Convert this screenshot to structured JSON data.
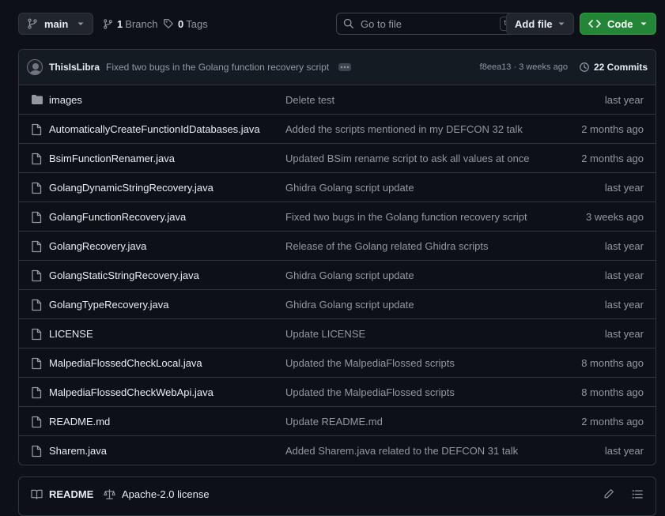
{
  "topbar": {
    "branch": "main",
    "branch_count": "1",
    "branch_label": "Branch",
    "tag_count": "0",
    "tag_label": "Tags",
    "search_placeholder": "Go to file",
    "search_shortcut": "t",
    "add_file_label": "Add file",
    "code_label": "Code"
  },
  "commit": {
    "author": "ThisIsLibra",
    "message": "Fixed two bugs in the Golang function recovery script",
    "sha_time": "f8eea13 · 3 weeks ago",
    "commits_label": "22 Commits"
  },
  "files": [
    {
      "name": "images",
      "type": "folder",
      "message": "Delete test",
      "date": "last year"
    },
    {
      "name": "AutomaticallyCreateFunctionIdDatabases.java",
      "type": "file",
      "message": "Added the scripts mentioned in my DEFCON 32 talk",
      "date": "2 months ago"
    },
    {
      "name": "BsimFunctionRenamer.java",
      "type": "file",
      "message": "Updated BSim rename script to ask all values at once",
      "date": "2 months ago"
    },
    {
      "name": "GolangDynamicStringRecovery.java",
      "type": "file",
      "message": "Ghidra Golang script update",
      "date": "last year"
    },
    {
      "name": "GolangFunctionRecovery.java",
      "type": "file",
      "message": "Fixed two bugs in the Golang function recovery script",
      "date": "3 weeks ago"
    },
    {
      "name": "GolangRecovery.java",
      "type": "file",
      "message": "Release of the Golang related Ghidra scripts",
      "date": "last year"
    },
    {
      "name": "GolangStaticStringRecovery.java",
      "type": "file",
      "message": "Ghidra Golang script update",
      "date": "last year"
    },
    {
      "name": "GolangTypeRecovery.java",
      "type": "file",
      "message": "Ghidra Golang script update",
      "date": "last year"
    },
    {
      "name": "LICENSE",
      "type": "file",
      "message": "Update LICENSE",
      "date": "last year"
    },
    {
      "name": "MalpediaFlossedCheckLocal.java",
      "type": "file",
      "message": "Updated the MalpediaFlossed scripts",
      "date": "8 months ago"
    },
    {
      "name": "MalpediaFlossedCheckWebApi.java",
      "type": "file",
      "message": "Updated the MalpediaFlossed scripts",
      "date": "8 months ago"
    },
    {
      "name": "README.md",
      "type": "file",
      "message": "Update README.md",
      "date": "2 months ago"
    },
    {
      "name": "Sharem.java",
      "type": "file",
      "message": "Added Sharem.java related to the DEFCON 31 talk",
      "date": "last year"
    }
  ],
  "readme_bar": {
    "readme_label": "README",
    "license_label": "Apache-2.0 license"
  },
  "colors": {
    "background": "#0d1117",
    "border": "#30363d",
    "code_button": "#238636",
    "muted_text": "#9198a1"
  }
}
